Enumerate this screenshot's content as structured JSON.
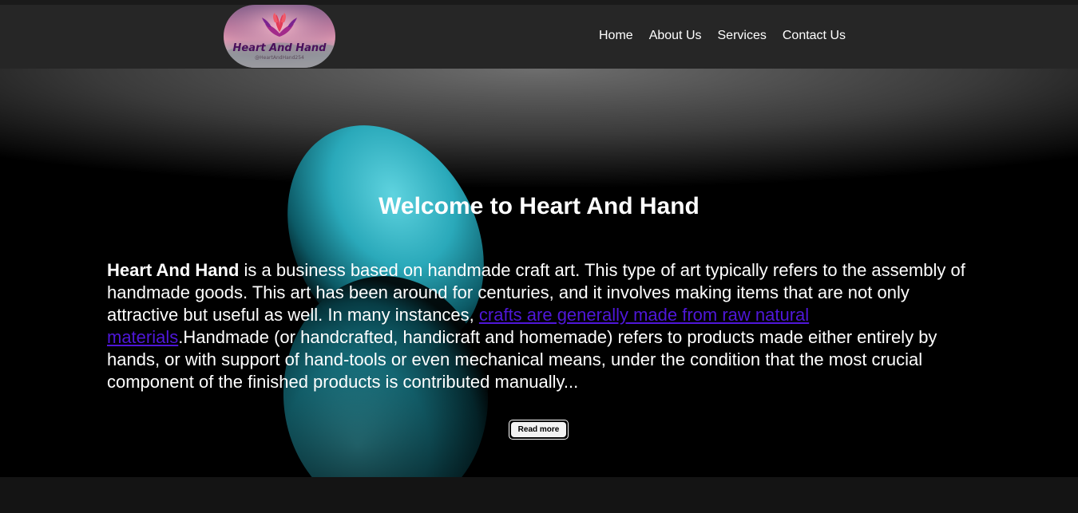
{
  "header": {
    "logo": {
      "title": "Heart And Hand",
      "subtitle": "@HeartAndHand254",
      "icon": "lotus-hands-icon"
    },
    "nav": [
      {
        "label": "Home"
      },
      {
        "label": "About Us"
      },
      {
        "label": "Services"
      },
      {
        "label": "Contact Us"
      }
    ]
  },
  "hero": {
    "title": "Welcome to Heart And Hand",
    "intro_bold": "Heart And Hand",
    "intro_text": " is a business based on handmade craft art. This type of art typically refers to the assembly of handmade goods. This art has been around for centuries, and it involves making items that are not only attractive but useful as well. In many instances, ",
    "link_text": "crafts are generally made from raw natural materials",
    "outro_text": ".Handmade (or handcrafted, handicraft and homemade) refers to products made either entirely by hands, or with support of hand-tools or even mechanical means, under the condition that the most crucial component of the finished products is contributed manually...",
    "button_label": "Read more",
    "image": "teal-stone-reflection"
  },
  "colors": {
    "navbar": "#262626",
    "hero_bg": "#000000",
    "link": "#4f17d9",
    "stone": "#2fb3c4",
    "footer": "#141414"
  }
}
